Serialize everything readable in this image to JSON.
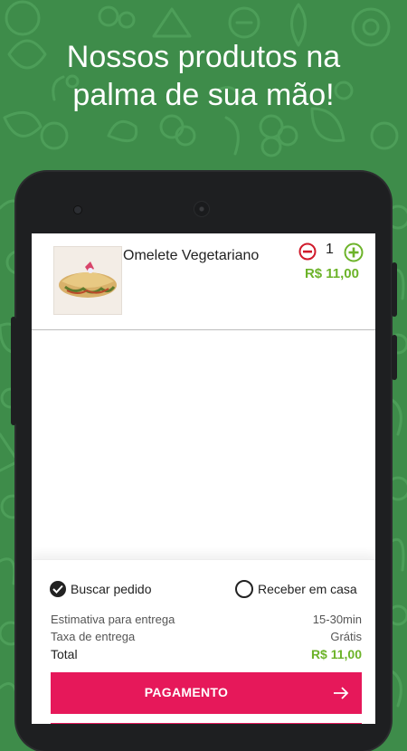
{
  "header": {
    "headline_line1": "Nossos produtos na",
    "headline_line2": "palma de sua mão!"
  },
  "cart": {
    "items": [
      {
        "name": "Omelete Vegetariano",
        "quantity": "1",
        "price": "R$ 11,00",
        "thumbnail_icon": "omelette-image"
      }
    ]
  },
  "delivery_options": {
    "pickup_label": "Buscar pedido",
    "pickup_selected": true,
    "delivery_label": "Receber em casa",
    "delivery_selected": false
  },
  "summary": {
    "estimate_label": "Estimativa para entrega",
    "estimate_value": "15-30min",
    "fee_label": "Taxa de entrega",
    "fee_value": "Grátis",
    "total_label": "Total",
    "total_value": "R$ 11,00"
  },
  "actions": {
    "pay_label": "PAGAMENTO"
  },
  "colors": {
    "background_green": "#3e8c4a",
    "accent_pink": "#e6185a",
    "price_green": "#6cb329",
    "minus_red": "#d0192a",
    "plus_green": "#6cb329"
  }
}
